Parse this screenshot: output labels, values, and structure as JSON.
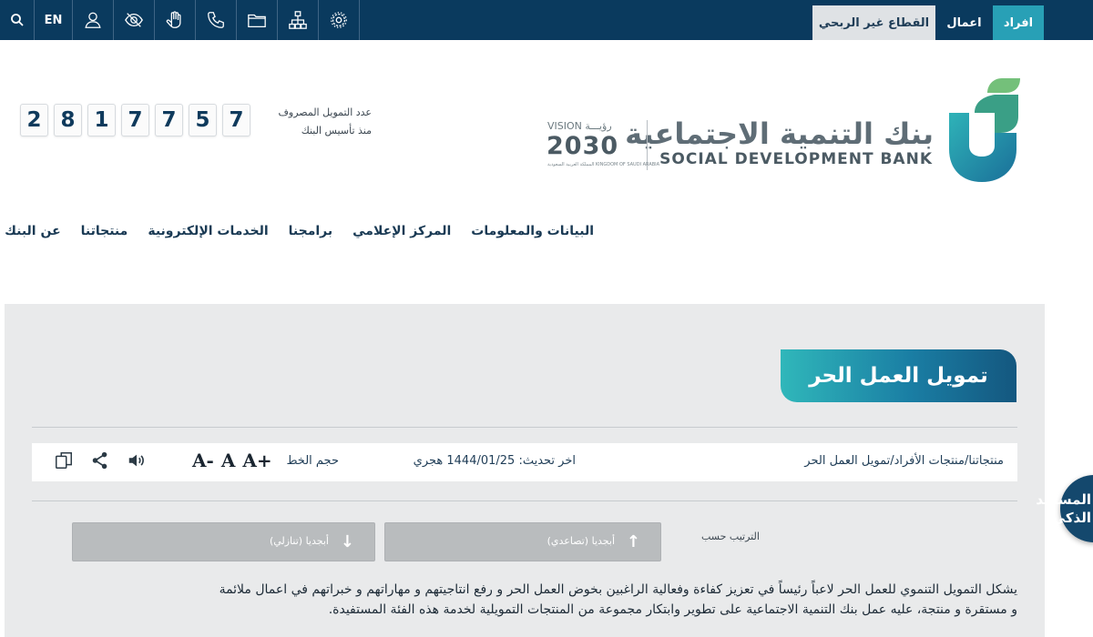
{
  "topbar": {
    "lang": "EN",
    "icons": [
      "search-icon",
      "user-icon",
      "eye-slash-icon",
      "sign-language-icon",
      "phone-icon",
      "folder-icon",
      "sitemap-icon",
      "gear-icon"
    ],
    "tabs": {
      "afrad": "افراد",
      "aamal": "اعمال",
      "nonprofit": "القطاع غير الربحي"
    },
    "colors": {
      "bar": "#0a3a5e",
      "active_tab": "#28a0b6",
      "nonprofit_tab": "#dfe2e5"
    }
  },
  "header": {
    "bank_name_ar": "بنك التنمية الاجتماعية",
    "bank_name_en": "SOCIAL DEVELOPMENT BANK",
    "vision": {
      "top": "VISION رؤيـــة",
      "year": "2030",
      "sub": "المملكة العربية السعودية KINGDOM OF SAUDI ARABIA"
    },
    "counter_label_line1": "عدد التمويل المصروف",
    "counter_label_line2": "منذ تأسيس البنك",
    "counter_digits": [
      "2",
      "8",
      "1",
      "7",
      "7",
      "5",
      "7"
    ]
  },
  "nav": {
    "items": [
      "عن البنك",
      "منتجاتنا",
      "الخدمات الإلكترونية",
      "برامجنا",
      "المركز الإعلامي",
      "البيانات والمعلومات"
    ]
  },
  "content": {
    "title": "تمويل العمل الحر",
    "breadcrumb": "منتجاتنا/منتجات الأفراد/تمويل العمل الحر",
    "last_updated": "اخر تحديث: 1444/01/25 هجري",
    "font_size_label": "حجم الخط",
    "font_sizes": [
      "A+",
      "A",
      "A-"
    ],
    "tool_icons": [
      "speaker-icon",
      "share-icon",
      "copy-icon"
    ],
    "sort_label": "الترتيب حسب",
    "sort_asc": "أبجديا (تصاعدي)",
    "sort_desc": "أبجديا (تنازلي)",
    "paragraph_line1": "يشكل التمويل التنموي للعمل الحر لاعباً رئيساً في تعزيز كفاءة وفعالية الراغبين بخوض العمل الحر و رفع انتاجيتهم و مهاراتهم و خبراتهم في اعمال ملائمة",
    "paragraph_line2": "و مستقرة و منتجة، عليه عمل بنك التنمية الاجتماعية على تطوير وابتكار مجموعة من المنتجات التمويلية لخدمة هذه الفئة المستفيدة."
  },
  "assistant": {
    "line1": "المساعد",
    "line2": "الذكي"
  }
}
